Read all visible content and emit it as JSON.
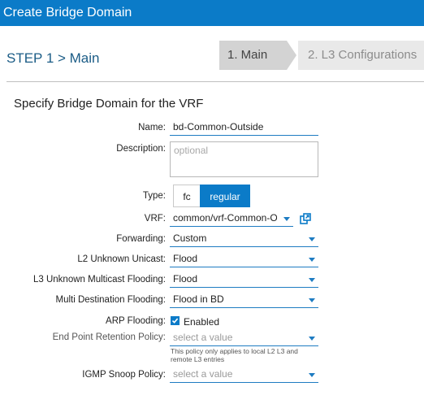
{
  "window": {
    "title": "Create Bridge Domain"
  },
  "steps": {
    "current": "STEP 1 > Main",
    "tab_main": "1. Main",
    "tab_l3": "2. L3 Configurations"
  },
  "section": {
    "title": "Specify Bridge Domain for the VRF"
  },
  "form": {
    "name": {
      "label": "Name:",
      "value": "bd-Common-Outside"
    },
    "description": {
      "label": "Description:",
      "placeholder": "optional"
    },
    "type": {
      "label": "Type:",
      "options": [
        "fc",
        "regular"
      ],
      "selected": "regular"
    },
    "vrf": {
      "label": "VRF:",
      "value": "common/vrf-Common-Ou"
    },
    "forwarding": {
      "label": "Forwarding:",
      "value": "Custom"
    },
    "l2_unknown_unicast": {
      "label": "L2 Unknown Unicast:",
      "value": "Flood"
    },
    "l3_unknown_multicast": {
      "label": "L3 Unknown Multicast Flooding:",
      "value": "Flood"
    },
    "multi_dest_flooding": {
      "label": "Multi Destination Flooding:",
      "value": "Flood in BD"
    },
    "arp_flooding": {
      "label": "ARP Flooding:",
      "checked": true,
      "text": "Enabled"
    },
    "endpoint_retention": {
      "label": "End Point Retention Policy:",
      "placeholder": "select a value",
      "hint": "This policy only applies to local L2 L3 and remote L3 entries"
    },
    "igmp_snoop": {
      "label": "IGMP Snoop Policy:",
      "placeholder": "select a value"
    }
  },
  "colors": {
    "accent": "#0b7bc8",
    "title_bar": "#0b7bc8"
  },
  "icons": {
    "vrf_link": "external-link-icon",
    "dropdown": "chevron-down-icon"
  }
}
